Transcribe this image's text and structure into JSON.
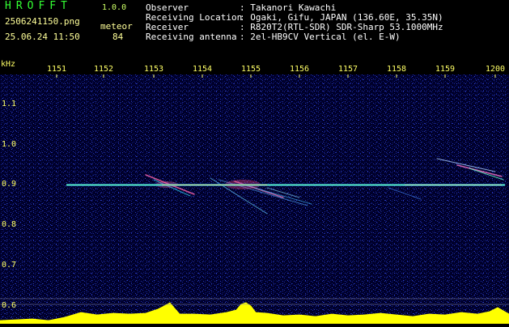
{
  "app": {
    "title": "HROFFT",
    "version": "1.0.0",
    "file_name": "2506241150.png",
    "timestamp": "25.06.24 11:50",
    "meteor_label": "meteor",
    "meteor_count": "84"
  },
  "info": [
    {
      "label": "Observer",
      "value": ": Takanori Kawachi"
    },
    {
      "label": "Receiving Location",
      "value": ": Ogaki, Gifu, JAPAN (136.60E, 35.35N)"
    },
    {
      "label": "Receiver",
      "value": ": R820T2(RTL-SDR) SDR-Sharp 53.1000MHz"
    },
    {
      "label": "Receiving antenna",
      "value": ": 2el-HB9CV Vertical (el. E-W)"
    }
  ],
  "axis": {
    "unit": "kHz",
    "freq_ticks": [
      "1151",
      "1152",
      "1153",
      "1154",
      "1155",
      "1156",
      "1157",
      "1158",
      "1159",
      "1200"
    ],
    "time_ticks": [
      "1.1",
      "1.0",
      "0.9",
      "0.8",
      "0.7",
      "0.6"
    ]
  },
  "colors": {
    "background": "#00001e",
    "carrier": "#66ff99",
    "power_trace": "#ffff00",
    "labels": "#ffff66"
  },
  "chart_data": {
    "type": "heatmap",
    "carrier_level": 0.9,
    "meteor_echo_centers_khz": [
      1153.5,
      1154.6,
      1155.3,
      1155.8,
      1159.6
    ]
  }
}
